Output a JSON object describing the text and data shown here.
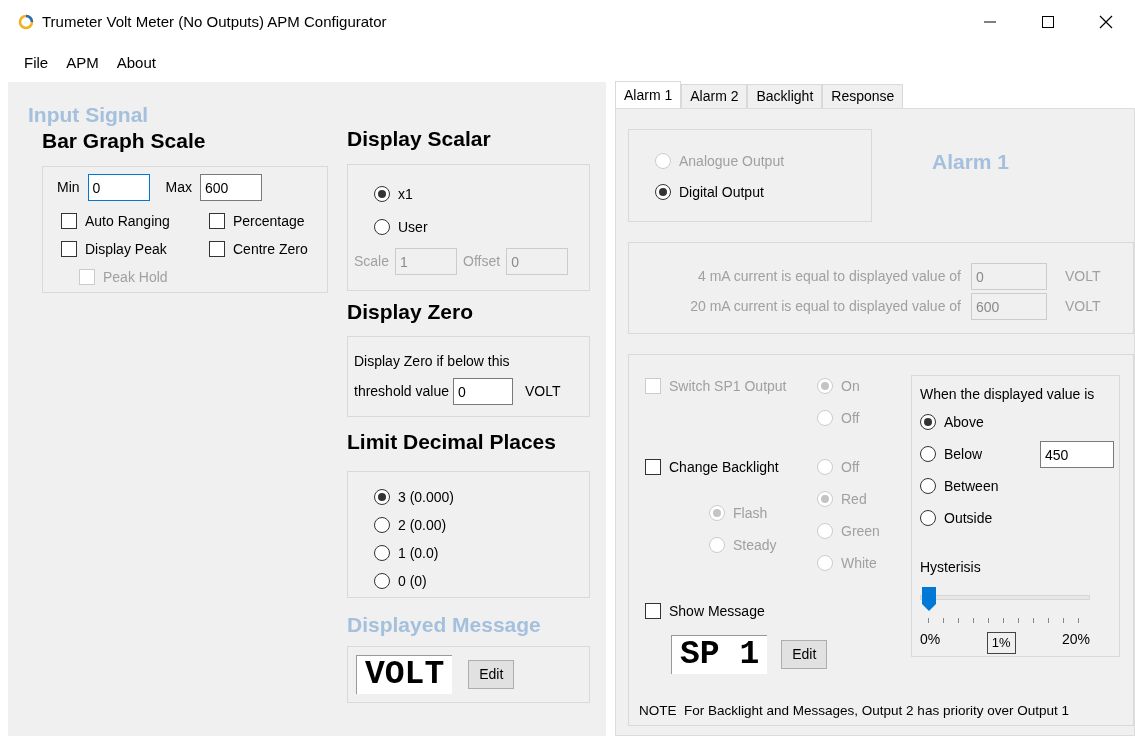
{
  "window": {
    "title": "Trumeter Volt Meter (No Outputs) APM Configurator"
  },
  "menu": [
    {
      "label": "File"
    },
    {
      "label": "APM"
    },
    {
      "label": "About"
    }
  ],
  "input_signal": {
    "heading": "Input Signal"
  },
  "bar_graph": {
    "heading": "Bar Graph Scale",
    "min_label": "Min",
    "min": "0",
    "max_label": "Max",
    "max": "600",
    "options": [
      {
        "label": "Auto Ranging",
        "checked": false,
        "disabled": false
      },
      {
        "label": "Percentage",
        "checked": false,
        "disabled": false
      },
      {
        "label": "Display Peak",
        "checked": false,
        "disabled": false
      },
      {
        "label": "Centre Zero",
        "checked": false,
        "disabled": false
      },
      {
        "label": "Peak Hold",
        "checked": false,
        "disabled": true
      }
    ]
  },
  "display_scalar": {
    "heading": "Display Scalar",
    "options": [
      {
        "label": "x1",
        "selected": true
      },
      {
        "label": "User",
        "selected": false
      }
    ],
    "fields": [
      {
        "label": "Scale",
        "value": "1",
        "disabled": true
      },
      {
        "label": "Offset",
        "value": "0",
        "disabled": true
      }
    ]
  },
  "display_zero": {
    "heading": "Display Zero",
    "text": "Display Zero if below this",
    "label": "threshold value",
    "value": "0",
    "unit": "VOLT"
  },
  "decimal_places": {
    "heading": "Limit Decimal Places",
    "options": [
      {
        "label": "3 (0.000)",
        "selected": true
      },
      {
        "label": "2 (0.00)",
        "selected": false
      },
      {
        "label": "1 (0.0)",
        "selected": false
      },
      {
        "label": "0 (0)",
        "selected": false
      }
    ]
  },
  "displayed_message": {
    "heading": "Displayed Message",
    "message": "VOLT",
    "button": "Edit"
  },
  "tabs": [
    {
      "label": "Alarm 1",
      "selected": true
    },
    {
      "label": "Alarm 2",
      "selected": false
    },
    {
      "label": "Backlight",
      "selected": false
    },
    {
      "label": "Response",
      "selected": false
    }
  ],
  "alarm": {
    "output_type": [
      {
        "label": "Analogue Output",
        "selected": false,
        "disabled": true
      },
      {
        "label": "Digital Output",
        "selected": true,
        "disabled": false
      }
    ],
    "title": "Alarm 1",
    "analogue": [
      {
        "label": "4 mA current is equal to displayed value of",
        "value": "0",
        "unit": "VOLT",
        "disabled": true
      },
      {
        "label": "20 mA current is equal to displayed value of",
        "value": "600",
        "unit": "VOLT",
        "disabled": true
      }
    ],
    "switch_output": {
      "label": "Switch SP1 Output",
      "checked": false,
      "disabled": true,
      "options": [
        {
          "label": "On",
          "selected": true,
          "disabled": true
        },
        {
          "label": "Off",
          "selected": false,
          "disabled": true
        }
      ]
    },
    "backlight": {
      "label": "Change Backlight",
      "checked": false,
      "disabled": false,
      "modes": [
        {
          "label": "Flash",
          "selected": true,
          "disabled": true
        },
        {
          "label": "Steady",
          "selected": false,
          "disabled": true
        }
      ],
      "colors": [
        {
          "label": "Off",
          "selected": false,
          "disabled": true
        },
        {
          "label": "Red",
          "selected": true,
          "disabled": true
        },
        {
          "label": "Green",
          "selected": false,
          "disabled": true
        },
        {
          "label": "White",
          "selected": false,
          "disabled": true
        }
      ]
    },
    "show_message": {
      "label": "Show Message",
      "checked": false,
      "disabled": false,
      "message": "SP 1",
      "button": "Edit"
    },
    "condition": {
      "heading": "When the displayed value is",
      "options": [
        {
          "label": "Above",
          "selected": true
        },
        {
          "label": "Below",
          "selected": false
        },
        {
          "label": "Between",
          "selected": false
        },
        {
          "label": "Outside",
          "selected": false
        }
      ],
      "value": "450"
    },
    "hysteresis": {
      "label": "Hysterisis",
      "level": 0.05,
      "min_label": "0%",
      "value_label": "1%",
      "max_label": "20%"
    },
    "note": "NOTE  For Backlight and Messages, Output 2 has priority over Output 1"
  }
}
